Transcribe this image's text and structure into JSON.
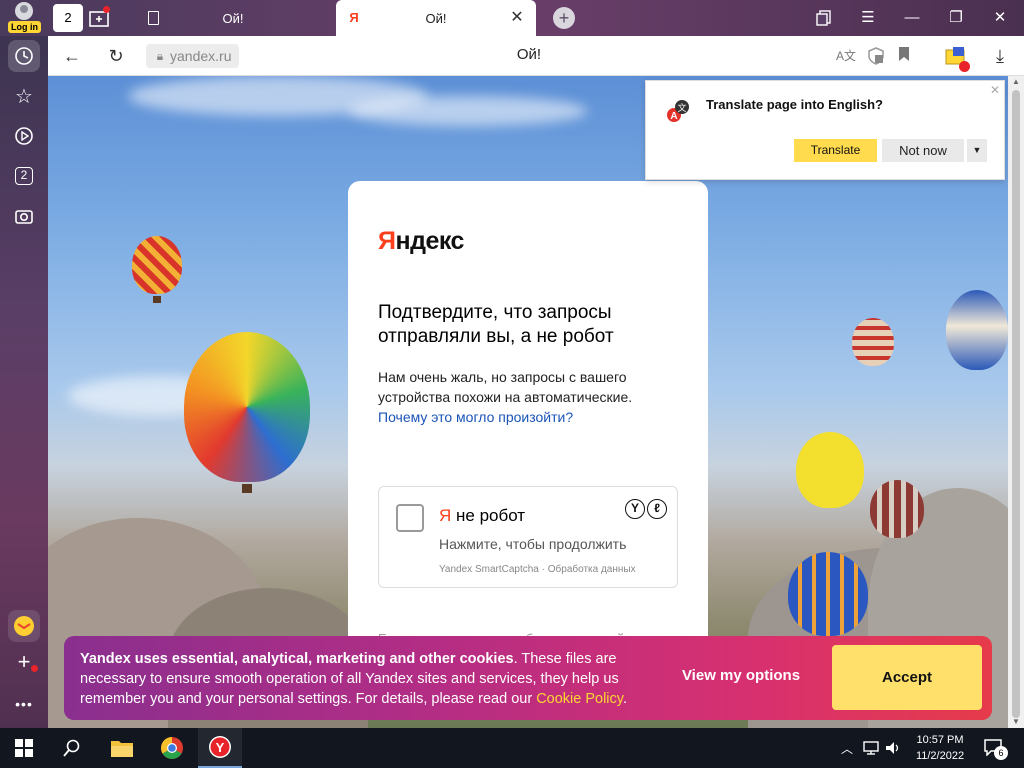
{
  "browser": {
    "login_label": "Log in",
    "home_tab_count": "2",
    "tabs": [
      {
        "title": "Ой!"
      },
      {
        "title": "Ой!",
        "favicon": "Я"
      }
    ],
    "sidebar_tab_count": "2",
    "address": {
      "domain": "yandex.ru",
      "page_title": "Ой!"
    }
  },
  "translate_popup": {
    "question": "Translate page into English?",
    "translate_label": "Translate",
    "not_now_label": "Not now"
  },
  "captcha_card": {
    "logo_red": "Я",
    "logo_rest": "ндекс",
    "heading": "Подтвердите, что запросы отправляли вы, а не робот",
    "description": "Нам очень жаль, но запросы с вашего устройства похожи на автоматические.",
    "why_link": "Почему это могло произойти?",
    "robot_red": "Я",
    "robot_rest": " не робот",
    "press_to_continue": "Нажмите, чтобы продолжить",
    "smartcaptcha_note": "Yandex SmartCaptcha · Обработка данных",
    "feedback_text": "Если у вас возникли проблемы, пожалуйста"
  },
  "cookie_banner": {
    "bold_text": "Yandex uses essential, analytical, marketing and other cookies",
    "text": ". These files are necessary to ensure smooth operation of all Yandex sites and services, they help us remember you and your personal settings. For details, please read our ",
    "policy_link": "Cookie Policy",
    "end": ".",
    "view_options_label": "View my options",
    "accept_label": "Accept"
  },
  "taskbar": {
    "time": "10:57 PM",
    "date": "11/2/2022",
    "notification_count": "6"
  },
  "colors": {
    "yandex_red": "#fc3f1d",
    "translate_yellow": "#ffdb4d",
    "accept_yellow": "#ffe06b",
    "link_blue": "#1a54b8"
  }
}
